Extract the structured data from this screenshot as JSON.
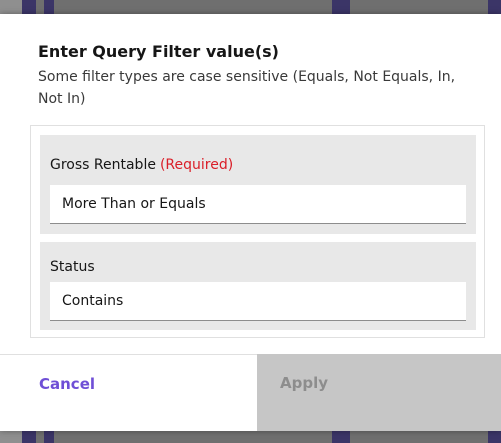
{
  "dialog": {
    "title": "Enter Query Filter value(s)",
    "subtitle": "Some filter types are case sensitive (Equals, Not Equals, In, Not In)"
  },
  "fields": [
    {
      "label": "Gross Rentable",
      "required_text": "(Required)",
      "value": "More Than or Equals"
    },
    {
      "label": "Status",
      "value": "Contains"
    }
  ],
  "buttons": {
    "cancel": "Cancel",
    "apply": "Apply"
  },
  "colors": {
    "accent": "#6f4fd6",
    "required": "#da1e28",
    "disabled_bg": "#c6c6c6"
  }
}
